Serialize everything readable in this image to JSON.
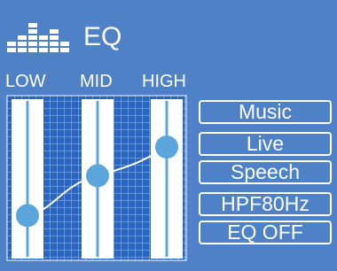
{
  "header": {
    "icon": "equalizer-bars-icon",
    "title": "EQ"
  },
  "bands": [
    {
      "label": "LOW",
      "level": 0.27
    },
    {
      "label": "MID",
      "level": 0.52
    },
    {
      "label": "HIGH",
      "level": 0.7
    }
  ],
  "presets": [
    "Music",
    "Live",
    "Speech",
    "HPF80Hz",
    "EQ OFF"
  ],
  "colors": {
    "background": "#4f81c7",
    "grid_bg": "#2a66c0",
    "slider_track": "#ffffff",
    "knob": "#5aa6dc",
    "text": "#ffffff"
  }
}
